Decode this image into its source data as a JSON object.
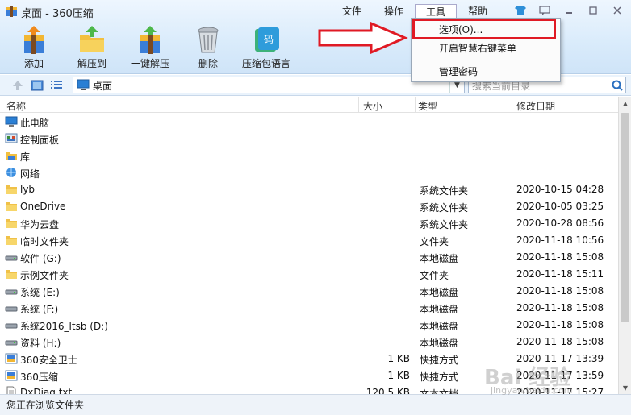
{
  "window": {
    "title": "桌面 - 360压缩"
  },
  "menu": {
    "items": [
      "文件",
      "操作",
      "工具",
      "帮助"
    ],
    "active_index": 2
  },
  "toolbar": {
    "items": [
      {
        "label": "添加",
        "icon": "add-archive-icon"
      },
      {
        "label": "解压到",
        "icon": "extract-to-icon"
      },
      {
        "label": "一键解压",
        "icon": "one-click-extract-icon"
      },
      {
        "label": "删除",
        "icon": "trash-icon"
      },
      {
        "label": "压缩包语言",
        "icon": "archive-language-icon"
      }
    ]
  },
  "tools_dropdown": {
    "items": [
      "选项(O)...",
      "开启智慧右键菜单",
      "管理密码"
    ],
    "highlighted_index": 0
  },
  "address": {
    "path": "桌面",
    "search_placeholder": "搜索当前目录"
  },
  "columns": {
    "name": "名称",
    "size": "大小",
    "type": "类型",
    "date": "修改日期"
  },
  "files": [
    {
      "name": "此电脑",
      "size": "",
      "type": "",
      "date": "",
      "icon": "computer-icon"
    },
    {
      "name": "控制面板",
      "size": "",
      "type": "",
      "date": "",
      "icon": "control-panel-icon"
    },
    {
      "name": "库",
      "size": "",
      "type": "",
      "date": "",
      "icon": "library-icon"
    },
    {
      "name": "网络",
      "size": "",
      "type": "",
      "date": "",
      "icon": "network-icon"
    },
    {
      "name": "lyb",
      "size": "",
      "type": "系统文件夹",
      "date": "2020-10-15 04:28",
      "icon": "folder-icon"
    },
    {
      "name": "OneDrive",
      "size": "",
      "type": "系统文件夹",
      "date": "2020-10-05 03:25",
      "icon": "folder-icon"
    },
    {
      "name": "华为云盘",
      "size": "",
      "type": "系统文件夹",
      "date": "2020-10-28 08:56",
      "icon": "folder-icon"
    },
    {
      "name": "临时文件夹",
      "size": "",
      "type": "文件夹",
      "date": "2020-11-18 10:56",
      "icon": "folder-icon"
    },
    {
      "name": "软件 (G:)",
      "size": "",
      "type": "本地磁盘",
      "date": "2020-11-18 15:08",
      "icon": "drive-icon"
    },
    {
      "name": "示例文件夹",
      "size": "",
      "type": "文件夹",
      "date": "2020-11-18 15:11",
      "icon": "folder-icon"
    },
    {
      "name": "系统 (E:)",
      "size": "",
      "type": "本地磁盘",
      "date": "2020-11-18 15:08",
      "icon": "drive-icon"
    },
    {
      "name": "系统 (F:)",
      "size": "",
      "type": "本地磁盘",
      "date": "2020-11-18 15:08",
      "icon": "drive-icon"
    },
    {
      "name": "系统2016_ltsb (D:)",
      "size": "",
      "type": "本地磁盘",
      "date": "2020-11-18 15:08",
      "icon": "drive-icon"
    },
    {
      "name": "资料 (H:)",
      "size": "",
      "type": "本地磁盘",
      "date": "2020-11-18 15:08",
      "icon": "drive-icon"
    },
    {
      "name": "360安全卫士",
      "size": "1 KB",
      "type": "快捷方式",
      "date": "2020-11-17 13:39",
      "icon": "shortcut-icon"
    },
    {
      "name": "360压缩",
      "size": "1 KB",
      "type": "快捷方式",
      "date": "2020-11-17 13:59",
      "icon": "shortcut-icon"
    },
    {
      "name": "DxDiag.txt",
      "size": "120.5 KB",
      "type": "文本文档",
      "date": "2020-11-17 15:27",
      "icon": "text-file-icon"
    }
  ],
  "status": {
    "text": "您正在浏览文件夹"
  },
  "watermark": {
    "text": "Bai 经验",
    "sub": "jingyan.baidu.com"
  }
}
